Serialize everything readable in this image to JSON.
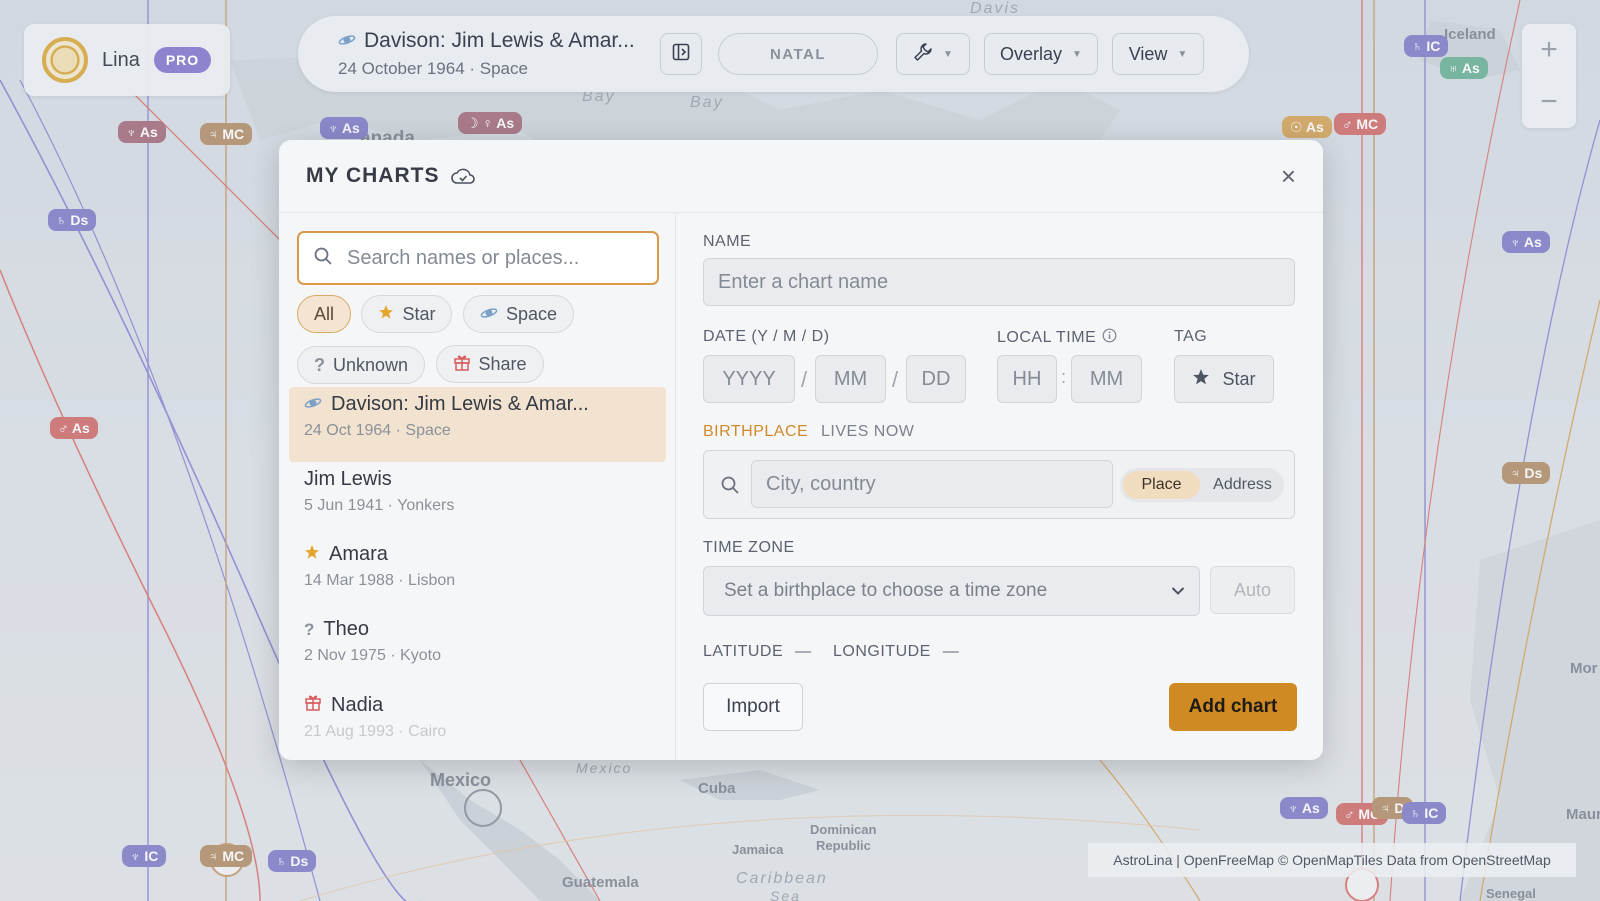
{
  "user": {
    "name": "Lina",
    "badge": "PRO"
  },
  "toolbar": {
    "chart_title": "Davison: Jim Lewis & Amar...",
    "chart_subtitle": "24 October 1964 · Space",
    "natal_label": "NATAL",
    "overlay_label": "Overlay",
    "view_label": "View"
  },
  "zoom": {
    "in": "+",
    "out": "−"
  },
  "map": {
    "labels": [
      "Davis",
      "Iceland",
      "Bay",
      "Bay",
      "anada",
      "Mexico",
      "Cuba",
      "Dominican",
      "Republic",
      "Jamaica",
      "Guatemala",
      "Mexico",
      "Caribbean",
      "Sea",
      "Mauritan",
      "Senegal",
      "Mor"
    ],
    "attribution": "AstroLina | OpenFreeMap © OpenMapTiles Data from OpenStreetMap",
    "pills": [
      "♆ As",
      "♃ MC",
      "♄ Ds",
      "♂ As",
      "♆ As",
      "☽ ♀ As",
      "♄ IC",
      "♅ As",
      "♆ As",
      "☉ As",
      "♂ MC",
      "♃ Ds",
      "♆ IC",
      "♃ MC",
      "♄ Ds",
      "♆ As",
      "♂ MC",
      "♃ D",
      "♄ IC"
    ]
  },
  "modal": {
    "title": "MY CHARTS",
    "close": "×",
    "search_placeholder": "Search names or places...",
    "filters": [
      {
        "label": "All",
        "icon": "none"
      },
      {
        "label": "Star",
        "icon": "star-icon"
      },
      {
        "label": "Space",
        "icon": "planet-icon"
      },
      {
        "label": "Unknown",
        "icon": "question-icon"
      },
      {
        "label": "Share",
        "icon": "gift-icon"
      }
    ],
    "charts": [
      {
        "name": "Davison: Jim Lewis & Amar...",
        "sub": "24 Oct 1964 · Space",
        "icon": "planet-icon"
      },
      {
        "name": "Jim Lewis",
        "sub": "5 Jun 1941 · Yonkers",
        "icon": "none"
      },
      {
        "name": "Amara",
        "sub": "14 Mar 1988 · Lisbon",
        "icon": "star-icon"
      },
      {
        "name": "Theo",
        "sub": "2 Nov 1975 · Kyoto",
        "icon": "question-icon"
      },
      {
        "name": "Nadia",
        "sub": "21 Aug 1993 · Cairo",
        "icon": "gift-icon"
      }
    ],
    "form": {
      "name_label": "NAME",
      "name_placeholder": "Enter a chart name",
      "date_label": "DATE (Y / M / D)",
      "yyyy": "YYYY",
      "mm": "MM",
      "dd": "DD",
      "time_label": "LOCAL TIME",
      "hh": "HH",
      "min": "MM",
      "tag_label": "TAG",
      "tag_value": "Star",
      "birthplace_tab": "BIRTHPLACE",
      "lives_now_tab": "LIVES NOW",
      "place_placeholder": "City, country",
      "toggle_place": "Place",
      "toggle_address": "Address",
      "tz_label": "TIME ZONE",
      "tz_placeholder": "Set a birthplace to choose a time zone",
      "auto": "Auto",
      "latitude_label": "LATITUDE",
      "latitude_value": "—",
      "longitude_label": "LONGITUDE",
      "longitude_value": "—",
      "import": "Import",
      "add": "Add chart"
    }
  },
  "colors": {
    "accent": "#d08a24",
    "pro": "#8c84cf",
    "selected_row": "#f1e3d0"
  }
}
